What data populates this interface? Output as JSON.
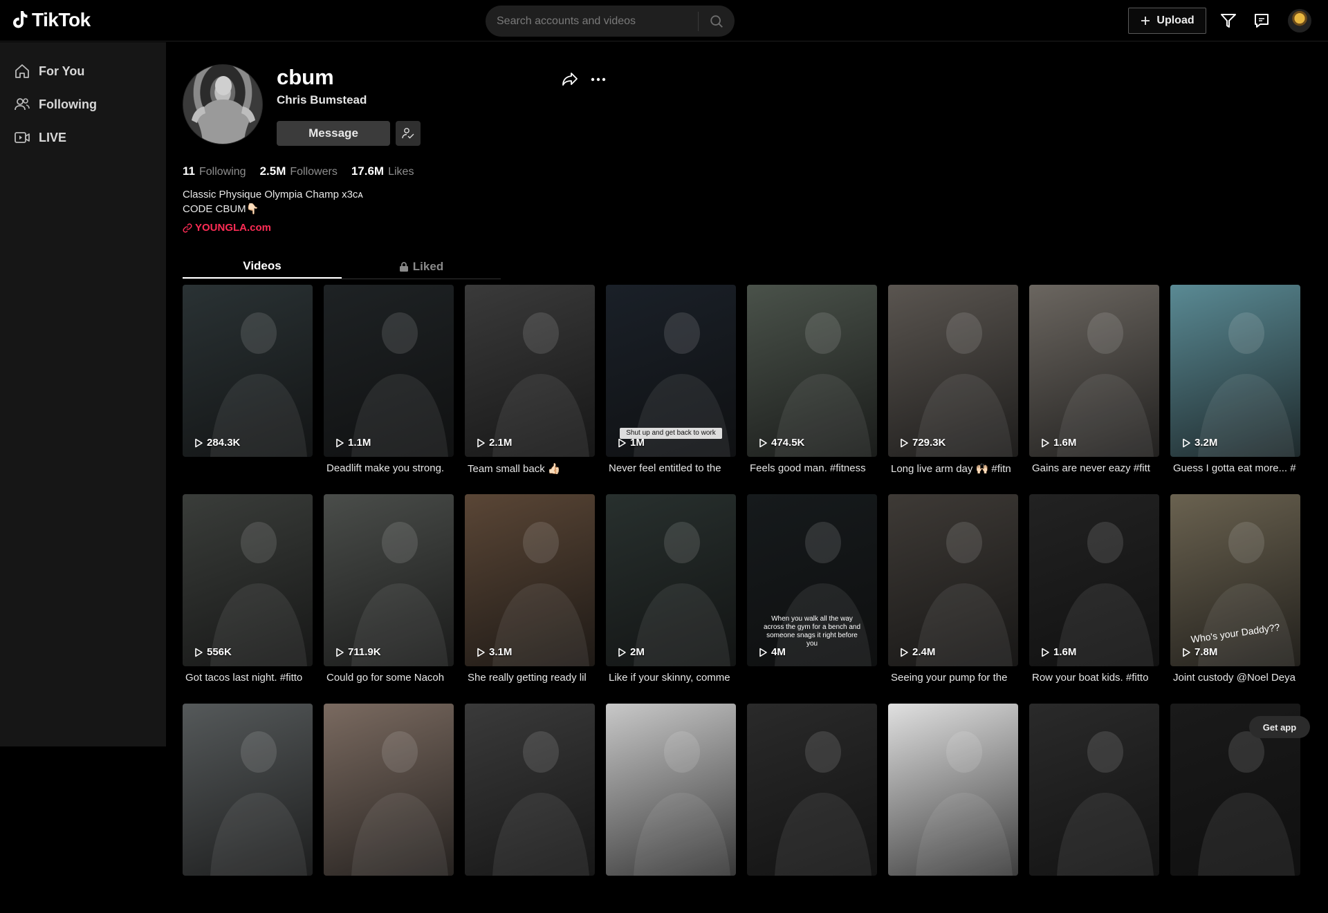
{
  "app": {
    "name": "TikTok"
  },
  "search": {
    "placeholder": "Search accounts and videos"
  },
  "header": {
    "upload_label": "Upload"
  },
  "sidebar": {
    "items": [
      {
        "label": "For You",
        "icon": "home-icon"
      },
      {
        "label": "Following",
        "icon": "users-icon"
      },
      {
        "label": "LIVE",
        "icon": "live-icon"
      }
    ]
  },
  "profile": {
    "username": "cbum",
    "display_name": "Chris Bumstead",
    "message_label": "Message",
    "stats": [
      {
        "value": "11",
        "label": "Following"
      },
      {
        "value": "2.5M",
        "label": "Followers"
      },
      {
        "value": "17.6M",
        "label": "Likes"
      }
    ],
    "bio_line1": "Classic Physique Olympia Champ x3ᴄᴀ",
    "bio_line2": "CODE CBUM👇🏻",
    "link": "YOUNGLA.com"
  },
  "tabs": [
    {
      "label": "Videos",
      "active": true
    },
    {
      "label": "Liked",
      "active": false
    }
  ],
  "videos": [
    {
      "views": "284.3K",
      "caption": "",
      "bg": "#2a3234",
      "overlay": ""
    },
    {
      "views": "1.1M",
      "caption": "Deadlift make you strong.",
      "bg": "#1e2224",
      "overlay": ""
    },
    {
      "views": "2.1M",
      "caption": "Team small back 👍🏻",
      "bg": "#3a3a3a",
      "overlay": ""
    },
    {
      "views": "1M",
      "caption": "Never feel entitled to the",
      "bg": "#1a2028",
      "overlay": "Shut up and get back to work"
    },
    {
      "views": "474.5K",
      "caption": "Feels good man. #fitness",
      "bg": "#4a524a",
      "overlay": ""
    },
    {
      "views": "729.3K",
      "caption": "Long live arm day 🙌🏻 #fitn",
      "bg": "#5a5550",
      "overlay": ""
    },
    {
      "views": "1.6M",
      "caption": "Gains are never eazy #fitt",
      "bg": "#6b6660",
      "overlay": ""
    },
    {
      "views": "3.2M",
      "caption": "Guess I gotta eat more... #",
      "bg": "#5a8a94",
      "overlay": ""
    },
    {
      "views": "556K",
      "caption": "Got tacos last night. #fitto",
      "bg": "#3a3d3a",
      "overlay": ""
    },
    {
      "views": "711.9K",
      "caption": "Could go for some Nacoh",
      "bg": "#4a4d4a",
      "overlay": ""
    },
    {
      "views": "3.1M",
      "caption": "She really getting ready lil",
      "bg": "#5a4636",
      "overlay": ""
    },
    {
      "views": "2M",
      "caption": "Like if your skinny, comme",
      "bg": "#28302e",
      "overlay": ""
    },
    {
      "views": "4M",
      "caption": "",
      "bg": "#161a1c",
      "overlay": "When you walk all the way across the gym for a bench and someone snags it right before you"
    },
    {
      "views": "2.4M",
      "caption": "Seeing your pump for the",
      "bg": "#3e3a36",
      "overlay": ""
    },
    {
      "views": "1.6M",
      "caption": "Row your boat kids. #fitto",
      "bg": "#222222",
      "overlay": ""
    },
    {
      "views": "7.8M",
      "caption": "Joint custody @Noel Deya",
      "bg": "#6a6250",
      "overlay": "Who's your Daddy??"
    },
    {
      "views": "",
      "caption": "",
      "bg": "#55595a",
      "overlay": ""
    },
    {
      "views": "",
      "caption": "",
      "bg": "#7a6a60",
      "overlay": ""
    },
    {
      "views": "",
      "caption": "",
      "bg": "#3a3a3a",
      "overlay": ""
    },
    {
      "views": "",
      "caption": "",
      "bg": "#c8c8c8",
      "overlay": ""
    },
    {
      "views": "",
      "caption": "",
      "bg": "#2a2a2a",
      "overlay": ""
    },
    {
      "views": "",
      "caption": "",
      "bg": "#e0e0e0",
      "overlay": ""
    },
    {
      "views": "",
      "caption": "",
      "bg": "#2a2a2a",
      "overlay": ""
    },
    {
      "views": "",
      "caption": "",
      "bg": "#1a1a1a",
      "overlay": ""
    }
  ],
  "get_app_label": "Get app",
  "colors": {
    "accent": "#fe2c55",
    "background": "#000000",
    "sidebar": "#161616"
  }
}
